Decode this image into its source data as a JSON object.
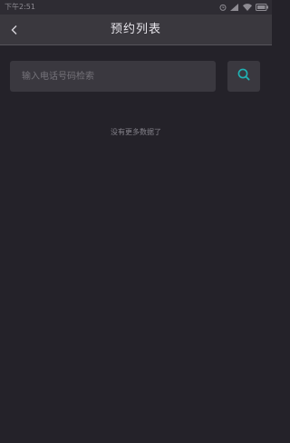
{
  "status_bar": {
    "time": "下午2:51",
    "icons": [
      "alarm-icon",
      "signal-icon",
      "wifi-icon",
      "battery-icon"
    ]
  },
  "nav": {
    "title": "预约列表",
    "back_icon": "chevron-left-icon"
  },
  "search": {
    "placeholder": "输入电话号码检索",
    "value": "",
    "button_icon": "search-icon",
    "accent_color": "#1fb3b5"
  },
  "list": {
    "empty_text": "没有更多数据了"
  }
}
